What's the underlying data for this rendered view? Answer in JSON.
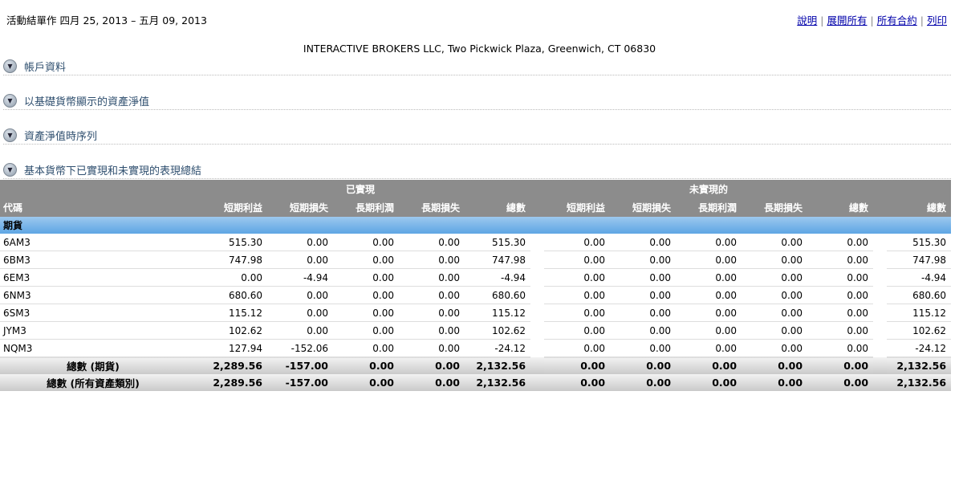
{
  "header": {
    "title": "活動結單作 四月 25, 2013 – 五月 09, 2013",
    "links": [
      "說明",
      "展開所有",
      "所有合約",
      "列印"
    ],
    "broker": "INTERACTIVE BROKERS LLC, Two Pickwick Plaza, Greenwich, CT 06830"
  },
  "sections": [
    "帳戶資料",
    "以基礎貨幣顯示的資產淨值",
    "資產淨值時序列",
    "基本貨幣下已實現和未實現的表現總結"
  ],
  "table": {
    "group_realized": "已實現",
    "group_unrealized": "未實現的",
    "columns": [
      "代碼",
      "短期利益",
      "短期損失",
      "長期利潤",
      "長期損失",
      "總數",
      "短期利益",
      "短期損失",
      "長期利潤",
      "長期損失",
      "總數",
      "總數"
    ],
    "category": "期貨",
    "rows": [
      [
        "6AM3",
        "515.30",
        "0.00",
        "0.00",
        "0.00",
        "515.30",
        "0.00",
        "0.00",
        "0.00",
        "0.00",
        "0.00",
        "515.30"
      ],
      [
        "6BM3",
        "747.98",
        "0.00",
        "0.00",
        "0.00",
        "747.98",
        "0.00",
        "0.00",
        "0.00",
        "0.00",
        "0.00",
        "747.98"
      ],
      [
        "6EM3",
        "0.00",
        "-4.94",
        "0.00",
        "0.00",
        "-4.94",
        "0.00",
        "0.00",
        "0.00",
        "0.00",
        "0.00",
        "-4.94"
      ],
      [
        "6NM3",
        "680.60",
        "0.00",
        "0.00",
        "0.00",
        "680.60",
        "0.00",
        "0.00",
        "0.00",
        "0.00",
        "0.00",
        "680.60"
      ],
      [
        "6SM3",
        "115.12",
        "0.00",
        "0.00",
        "0.00",
        "115.12",
        "0.00",
        "0.00",
        "0.00",
        "0.00",
        "0.00",
        "115.12"
      ],
      [
        "JYM3",
        "102.62",
        "0.00",
        "0.00",
        "0.00",
        "102.62",
        "0.00",
        "0.00",
        "0.00",
        "0.00",
        "0.00",
        "102.62"
      ],
      [
        "NQM3",
        "127.94",
        "-152.06",
        "0.00",
        "0.00",
        "-24.12",
        "0.00",
        "0.00",
        "0.00",
        "0.00",
        "0.00",
        "-24.12"
      ]
    ],
    "totals": [
      [
        "總數 (期貨)",
        "2,289.56",
        "-157.00",
        "0.00",
        "0.00",
        "2,132.56",
        "0.00",
        "0.00",
        "0.00",
        "0.00",
        "0.00",
        "2,132.56"
      ],
      [
        "總數 (所有資產類別)",
        "2,289.56",
        "-157.00",
        "0.00",
        "0.00",
        "2,132.56",
        "0.00",
        "0.00",
        "0.00",
        "0.00",
        "0.00",
        "2,132.56"
      ]
    ]
  }
}
